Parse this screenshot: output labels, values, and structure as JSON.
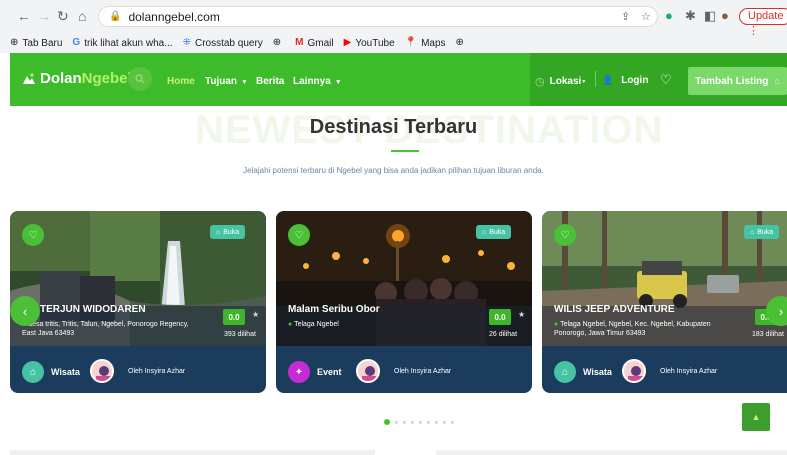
{
  "browser": {
    "url": "dolanngebel.com",
    "update_label": "Update",
    "bookmarks": [
      {
        "label": "Tab Baru",
        "icon": "globe-icon"
      },
      {
        "label": "trik lihat akun wha...",
        "icon": "google-icon"
      },
      {
        "label": "Crosstab query",
        "icon": "crosstab-icon"
      },
      {
        "label": "",
        "icon": "globe-icon"
      },
      {
        "label": "Gmail",
        "icon": "gmail-icon"
      },
      {
        "label": "YouTube",
        "icon": "youtube-icon"
      },
      {
        "label": "Maps",
        "icon": "maps-icon"
      },
      {
        "label": "",
        "icon": "globe-icon"
      }
    ]
  },
  "site": {
    "logo_part1": "Dolan",
    "logo_part2": "Ngebel.",
    "menu": [
      {
        "label": "Home",
        "active": true,
        "dropdown": false
      },
      {
        "label": "Tujuan",
        "active": false,
        "dropdown": true
      },
      {
        "label": "Berita",
        "active": false,
        "dropdown": false
      },
      {
        "label": "Lainnya",
        "active": false,
        "dropdown": true
      }
    ],
    "lokasi_label": "Lokasi",
    "login_label": "Login",
    "tambah_label": "Tambah Listing"
  },
  "section": {
    "watermark": "NEWEST DESTINATION",
    "title": "Destinasi Terbaru",
    "subtitle": "Jelajahi potensi terbaru di Ngebel yang bisa anda jadikan pilihan tujuan liburan anda."
  },
  "cards": [
    {
      "status": "Buka",
      "name": "TERJUN WIDODAREN",
      "location": "desa tritis, Tritis, Talun, Ngebel, Ponorogo Regency, East Java 63493",
      "score": "0.0",
      "views": "393 dilihat",
      "category": "Wisata",
      "author": "Oleh Insyira Azhar"
    },
    {
      "status": "Buka",
      "name": "Malam Seribu Obor",
      "location": "Telaga Ngebel",
      "score": "0.0",
      "views": "26 dilihat",
      "category": "Event",
      "author": "Oleh Insyira Azhar"
    },
    {
      "status": "Buka",
      "name": "WILIS JEEP ADVENTURE",
      "location": "Telaga Ngebel, Ngebel, Kec. Ngebel, Kabupaten Ponorogo, Jawa Timur 63493",
      "score": "0.0",
      "views": "183 dilihat",
      "category": "Wisata",
      "author": "Oleh Insyira Azhar"
    }
  ],
  "colors": {
    "brand_green": "#3dbb2a",
    "dark_green": "#33a724",
    "event_purple": "#c52bd6",
    "teal_category": "#46c3a2"
  }
}
